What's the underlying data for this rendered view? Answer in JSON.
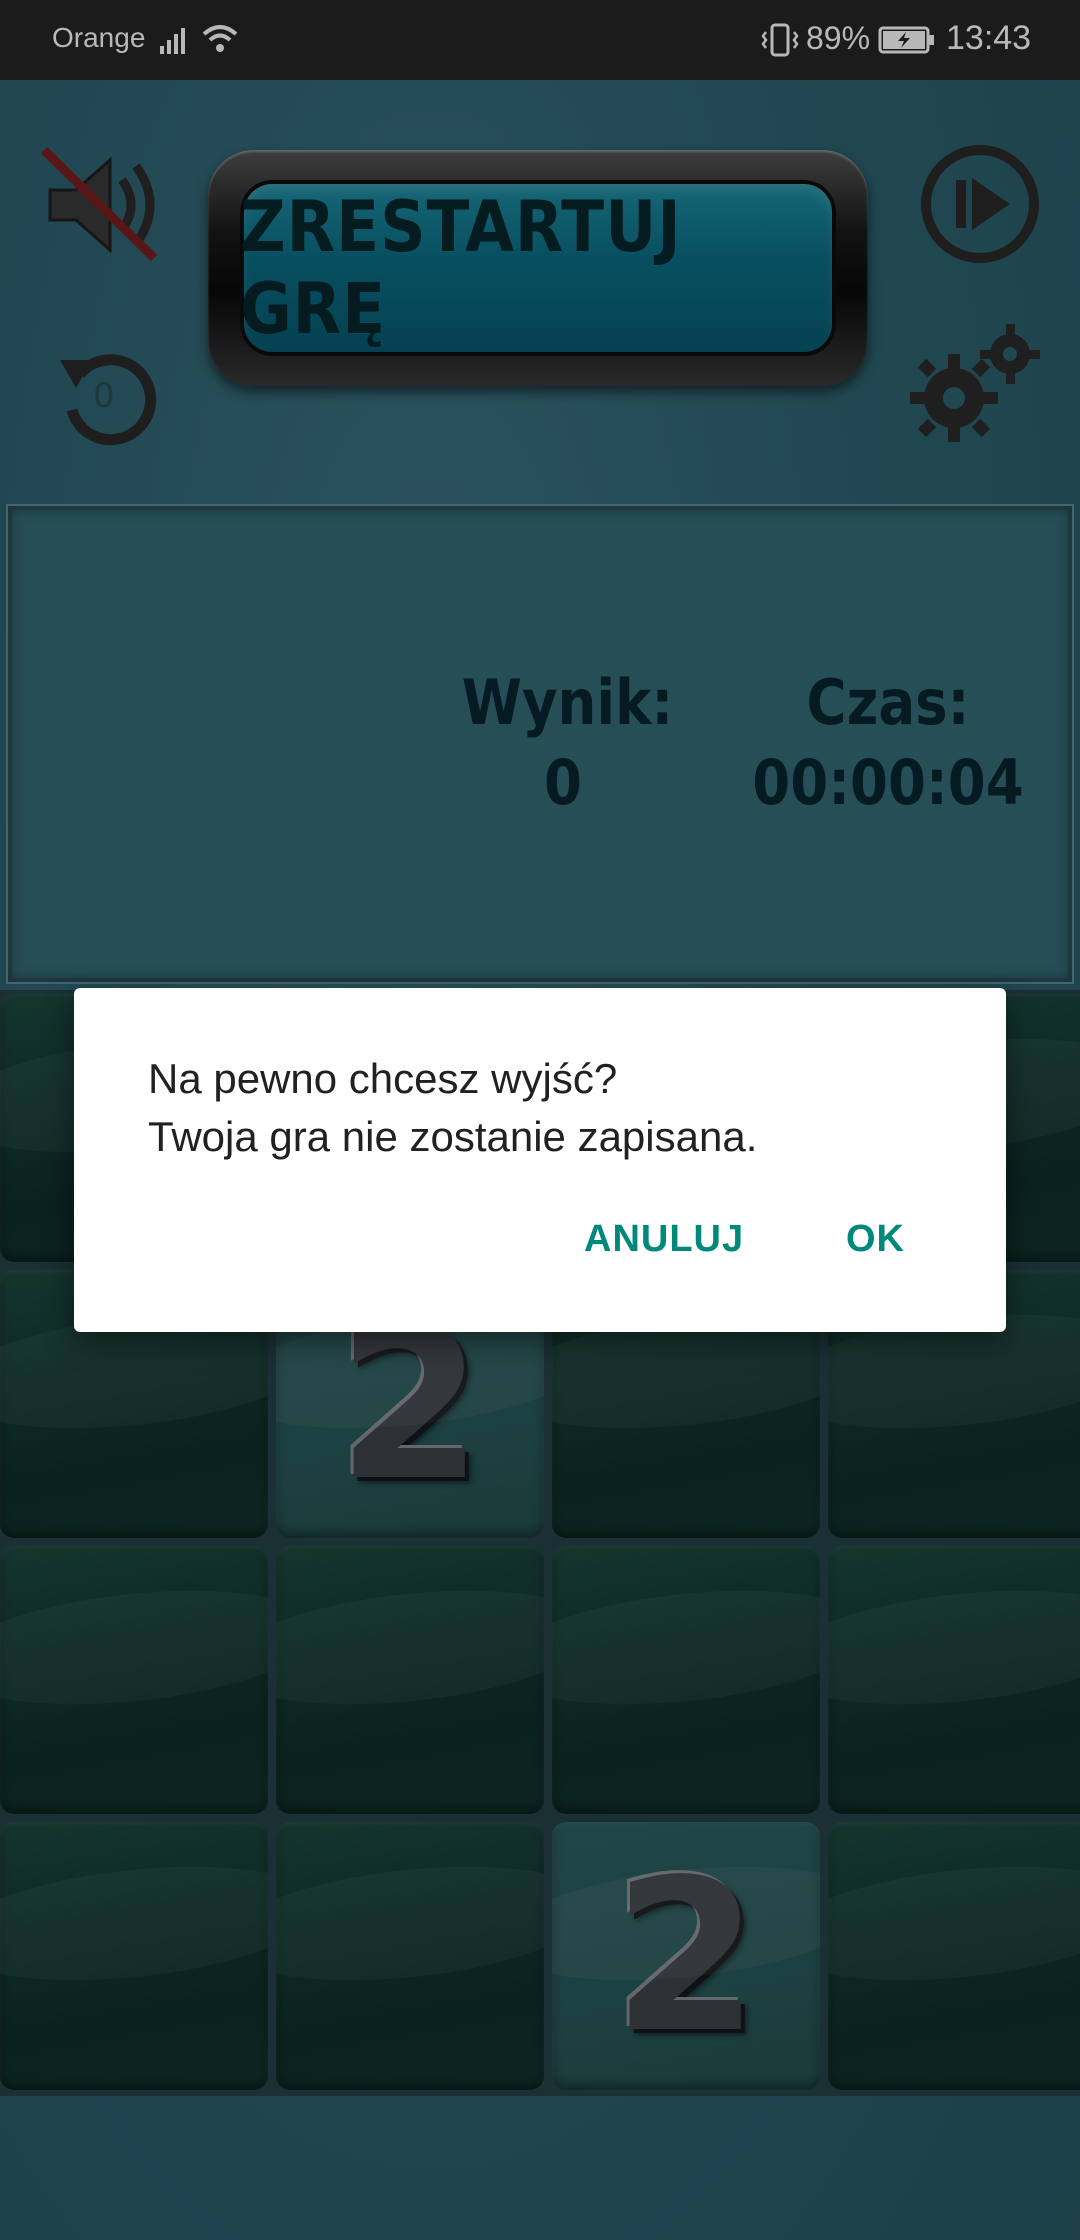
{
  "status_bar": {
    "carrier": "Orange",
    "battery": "89%",
    "time": "13:43",
    "icons": [
      "signal-icon",
      "wifi-icon",
      "vibrate-icon",
      "battery-charging-icon"
    ]
  },
  "toolbar": {
    "restart_label": "ZRESTARTUJ GRĘ",
    "undo_count": "0",
    "icons": [
      "sound-muted-icon",
      "play-icon",
      "undo-icon",
      "settings-gears-icon"
    ]
  },
  "score": {
    "score_label": "Wynik:",
    "score_value": "0",
    "time_label": "Czas:",
    "time_value": "00:00:04"
  },
  "board": {
    "rows": 4,
    "cols": 4,
    "tiles": [
      [
        "",
        "",
        "",
        ""
      ],
      [
        "",
        "2",
        "",
        ""
      ],
      [
        "",
        "",
        "",
        ""
      ],
      [
        "",
        "",
        "2",
        ""
      ]
    ]
  },
  "dialog": {
    "message_line1": "Na pewno chcesz wyjść?",
    "message_line2": "Twoja gra nie zostanie zapisana.",
    "cancel_label": "ANULUJ",
    "ok_label": "OK"
  },
  "colors": {
    "background": "#2f6470",
    "restart_button": "#0b6e86",
    "tile": "#133a33",
    "dialog_accent": "#00897b"
  }
}
